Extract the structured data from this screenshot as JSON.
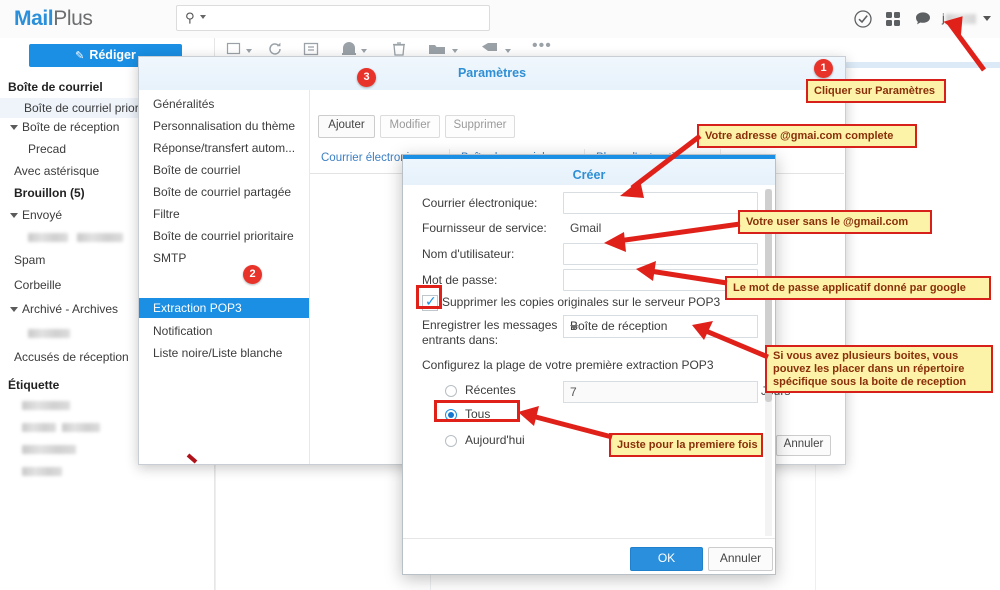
{
  "app": {
    "logo_mail": "Mail",
    "logo_plus": "Plus",
    "search_placeholder": "",
    "search_icon": "search-icon",
    "user_caret": "chevron-down-icon"
  },
  "header_icons": [
    {
      "name": "check-circle-icon",
      "glyph": "✓"
    },
    {
      "name": "apps-grid-icon",
      "glyph": "⚇"
    },
    {
      "name": "chat-bubble-icon",
      "glyph": "●"
    }
  ],
  "sidebar": {
    "compose_label": "Rédiger",
    "section_mailbox": "Boîte de courriel",
    "section_label": "Étiquette",
    "items": [
      {
        "label": "Boîte de courriel prioritaire",
        "selected": true
      },
      {
        "label": "Boîte de réception",
        "expander": true
      },
      {
        "label": "Precad"
      },
      {
        "label": "Avec astérisque"
      },
      {
        "label": "Brouillon (5)",
        "bold": true
      },
      {
        "label": "Envoyé",
        "expander": true
      },
      {
        "label": "",
        "blurred": true
      },
      {
        "label": "Spam"
      },
      {
        "label": "Corbeille"
      },
      {
        "label": "Archivé - Archives",
        "expander": true
      },
      {
        "label": "",
        "blurred": true
      },
      {
        "label": "Accusés de réception"
      }
    ],
    "tag_items": [
      {
        "label": "",
        "blurred": true
      },
      {
        "label": "",
        "blurred": true
      },
      {
        "label": "",
        "blurred": true
      },
      {
        "label": "",
        "blurred": true
      }
    ]
  },
  "mail_toolbar": [
    {
      "name": "select-all-checkbox-icon"
    },
    {
      "name": "refresh-icon"
    },
    {
      "name": "archive-icon"
    },
    {
      "name": "junk-icon"
    },
    {
      "name": "delete-icon"
    },
    {
      "name": "move-to-folder-icon"
    },
    {
      "name": "tag-icon"
    },
    {
      "name": "more-actions-icon"
    }
  ],
  "settings": {
    "title": "Paramètres",
    "buttons": {
      "add": "Ajouter",
      "edit": "Modifier",
      "delete": "Supprimer",
      "cancel": "Annuler"
    },
    "menu": [
      {
        "label": "Généralités"
      },
      {
        "label": "Personnalisation du thème"
      },
      {
        "label": "Réponse/transfert autom..."
      },
      {
        "label": "Boîte de courriel"
      },
      {
        "label": "Boîte de courriel partagée"
      },
      {
        "label": "Filtre"
      },
      {
        "label": "Boîte de courriel prioritaire"
      },
      {
        "label": "SMTP"
      },
      {
        "label": "Extraction POP3",
        "active": true
      },
      {
        "label": "Notification"
      },
      {
        "label": "Liste noire/Liste blanche"
      }
    ],
    "tabs": [
      {
        "label": "Courrier électronique"
      },
      {
        "label": "Boîte de courriel"
      },
      {
        "label": "Plage d'extraction"
      }
    ]
  },
  "create_dialog": {
    "title": "Créer",
    "fields": [
      {
        "label": "Courrier électronique:",
        "value": ""
      },
      {
        "label": "Fournisseur de service:",
        "value": "Gmail"
      },
      {
        "label": "Nom d'utilisateur:",
        "value": ""
      },
      {
        "label": "Mot de passe:",
        "value": ""
      }
    ],
    "checkbox": {
      "label": "Supprimer les copies originales sur le serveur POP3",
      "checked": true
    },
    "save_to_label_line1": "Enregistrer les messages",
    "save_to_label_line2": "entrants dans:",
    "save_to_value": "Boîte de réception",
    "range_label": "Configurez la plage de votre première extraction POP3",
    "radios": [
      {
        "label": "Récentes",
        "selected": false
      },
      {
        "label": "Tous",
        "selected": true
      },
      {
        "label": "Aujourd'hui",
        "selected": false
      }
    ],
    "days_value": "7",
    "days_unit": "Jours",
    "ok_label": "OK",
    "cancel_label": "Annuler"
  },
  "annotations": [
    {
      "id": "a1",
      "badge": "1",
      "text": "Cliquer sur Paramètres"
    },
    {
      "id": "a2",
      "badge": "2",
      "text": ""
    },
    {
      "id": "a3",
      "badge": "3",
      "text": ""
    },
    {
      "id": "a4",
      "text": "Votre adresse @gmai.com complete"
    },
    {
      "id": "a5",
      "text": "Votre user  sans le @gmail.com"
    },
    {
      "id": "a6",
      "text": "Le mot de passe applicatif donné par google"
    },
    {
      "id": "a7",
      "text": "Si vous avez plusieurs boites, vous pouvez les placer dans un répertoire spécifique sous la boite de reception"
    },
    {
      "id": "a8",
      "text": "Juste pour la premiere fois"
    }
  ],
  "colors": {
    "brand_blue": "#1a8fe3",
    "annotation_bg": "#fdf3a8",
    "annotation_border": "#d8201a",
    "badge_red": "#e8332a"
  }
}
